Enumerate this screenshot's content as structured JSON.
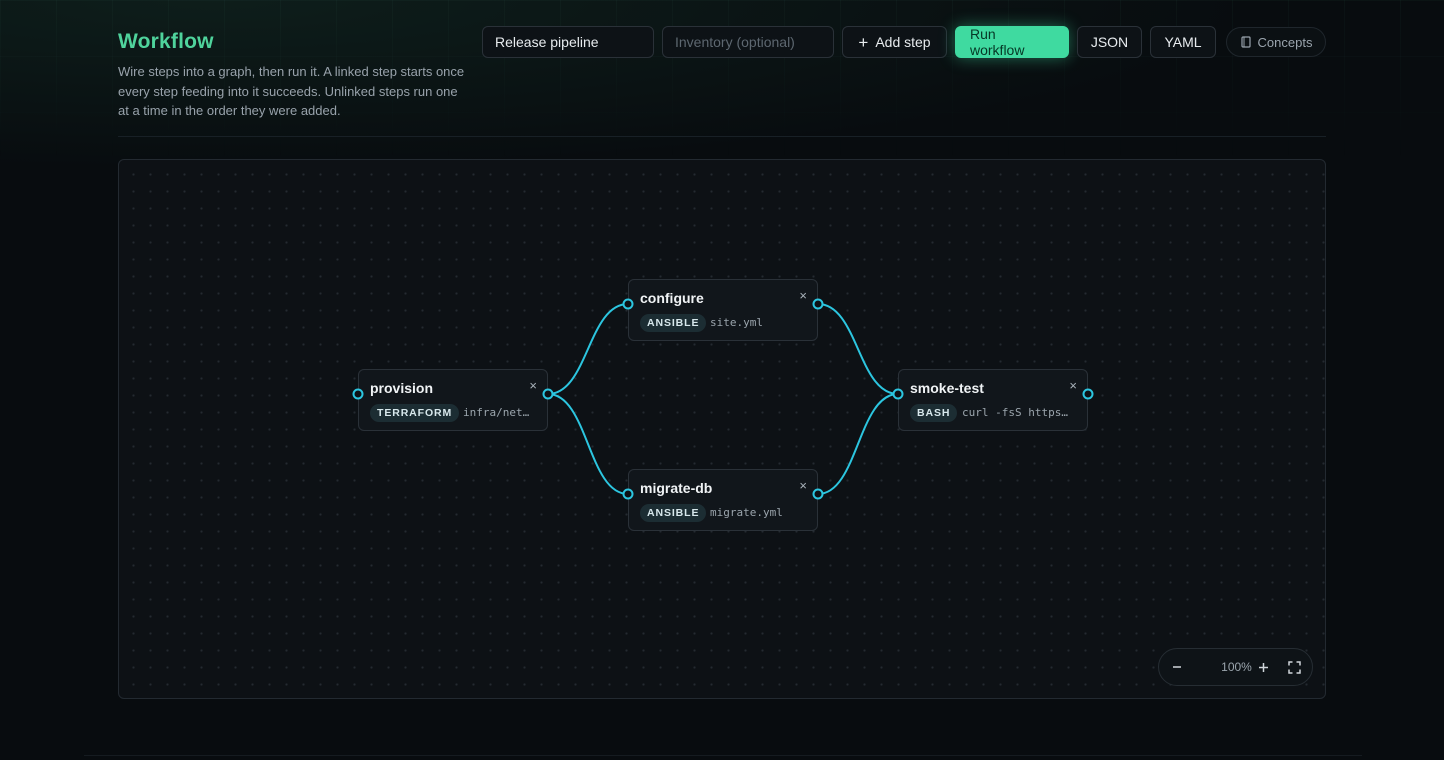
{
  "header": {
    "title": "Workflow",
    "description": "Wire steps into a graph, then run it. A linked step starts once every step feeding into it succeeds. Unlinked steps run one at a time in the order they were added."
  },
  "toolbar": {
    "name_value": "Release pipeline",
    "inventory_placeholder": "Inventory (optional)",
    "add_step_label": "Add step",
    "run_label": "Run workflow",
    "json_label": "JSON",
    "yaml_label": "YAML",
    "concepts_label": "Concepts"
  },
  "graph": {
    "nodes": [
      {
        "id": "provision",
        "title": "provision",
        "tag": "TERRAFORM",
        "detail": "infra/net…"
      },
      {
        "id": "configure",
        "title": "configure",
        "tag": "ANSIBLE",
        "detail": "site.yml"
      },
      {
        "id": "migrate-db",
        "title": "migrate-db",
        "tag": "ANSIBLE",
        "detail": "migrate.yml"
      },
      {
        "id": "smoke-test",
        "title": "smoke-test",
        "tag": "BASH",
        "detail": "curl -fsS https…"
      }
    ],
    "edges": [
      {
        "from": "provision",
        "to": "configure"
      },
      {
        "from": "provision",
        "to": "migrate-db"
      },
      {
        "from": "configure",
        "to": "smoke-test"
      },
      {
        "from": "migrate-db",
        "to": "smoke-test"
      }
    ],
    "close_symbol": "×"
  },
  "zoom": {
    "level": "100%"
  },
  "colors": {
    "accent": "#3fdaa0",
    "title": "#4fd39c",
    "wire": "#2cc6e0",
    "port": "#2cc6e0"
  }
}
